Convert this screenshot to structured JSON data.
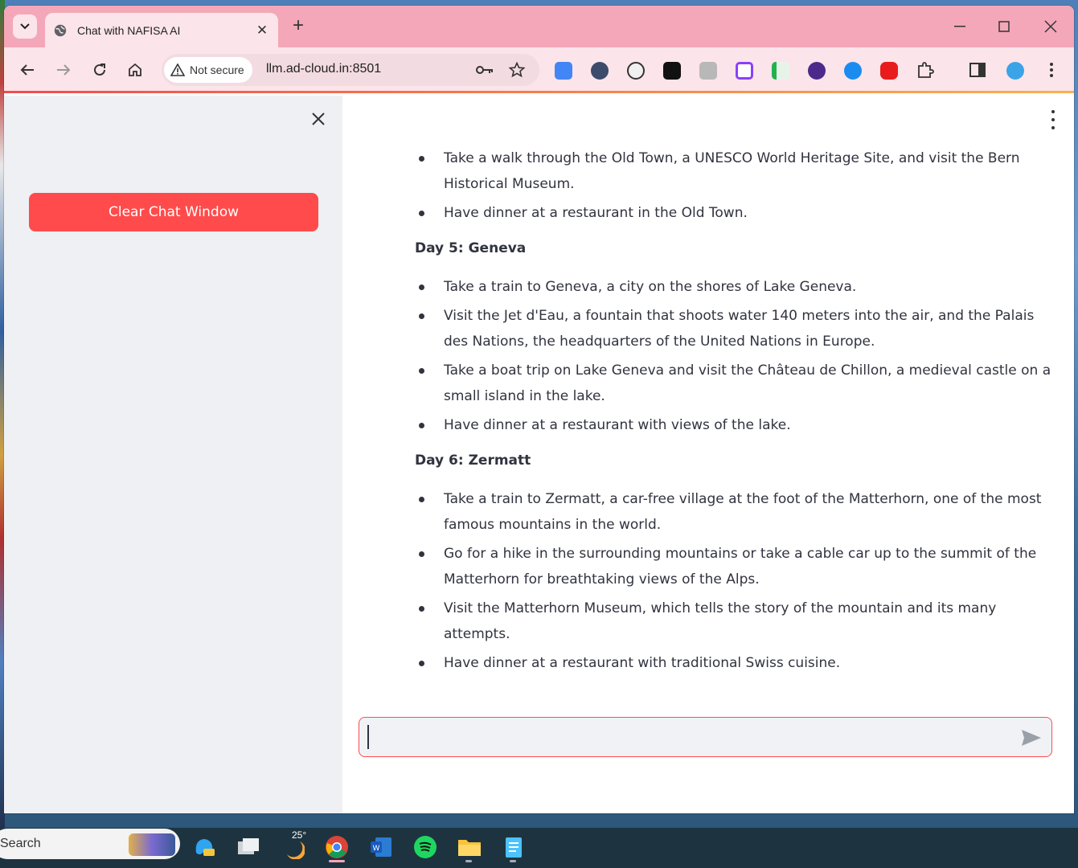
{
  "browser": {
    "tab_title": "Chat with NAFISA AI",
    "security_label": "Not secure",
    "url": "llm.ad-cloud.in:8501"
  },
  "sidebar": {
    "clear_button_label": "Clear Chat Window"
  },
  "message": {
    "day4_items": [
      "Take a walk through the Old Town, a UNESCO World Heritage Site, and visit the Bern Historical Museum.",
      "Have dinner at a restaurant in the Old Town."
    ],
    "day5_heading": "Day 5: Geneva",
    "day5_items": [
      "Take a train to Geneva, a city on the shores of Lake Geneva.",
      "Visit the Jet d'Eau, a fountain that shoots water 140 meters into the air, and the Palais des Nations, the headquarters of the United Nations in Europe.",
      "Take a boat trip on Lake Geneva and visit the Château de Chillon, a medieval castle on a small island in the lake.",
      "Have dinner at a restaurant with views of the lake."
    ],
    "day6_heading": "Day 6: Zermatt",
    "day6_items": [
      "Take a train to Zermatt, a car-free village at the foot of the Matterhorn, one of the most famous mountains in the world.",
      "Go for a hike in the surrounding mountains or take a cable car up to the summit of the Matterhorn for breathtaking views of the Alps.",
      "Visit the Matterhorn Museum, which tells the story of the mountain and its many attempts.",
      "Have dinner at a restaurant with traditional Swiss cuisine."
    ]
  },
  "chat_input": {
    "value": ""
  },
  "taskbar": {
    "search_label": "Search",
    "weather_temp": "25°"
  },
  "colors": {
    "accent": "#ff4b4b",
    "tabstrip": "#f4a7b9",
    "toolbar": "#fbe4ea",
    "sidebar_bg": "#eff0f3",
    "text": "#31333f"
  }
}
